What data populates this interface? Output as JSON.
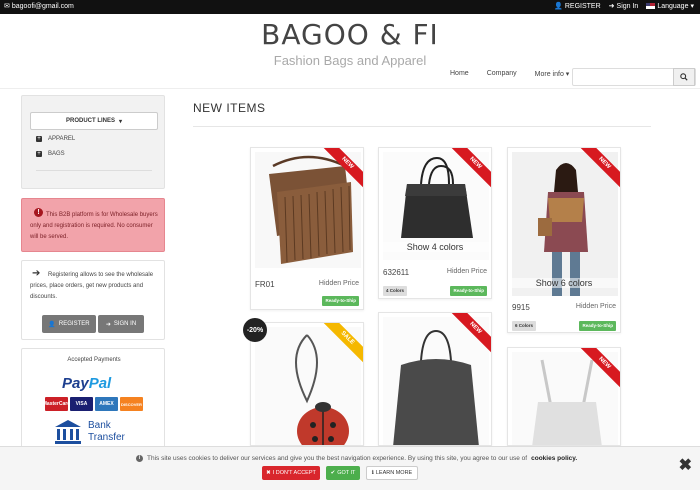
{
  "topbar": {
    "email": "bagoofi@gmail.com",
    "register": "REGISTER",
    "signin": "Sign In",
    "language": "Language"
  },
  "brand": {
    "title": "BAGOO & FI",
    "subtitle": "Fashion Bags and Apparel"
  },
  "nav": {
    "home": "Home",
    "company": "Company",
    "more": "More info"
  },
  "search": {
    "placeholder": ""
  },
  "sidebar": {
    "product_lines": "PRODUCT LINES",
    "items": [
      {
        "label": "APPAREL"
      },
      {
        "label": "BAGS"
      }
    ],
    "alert": "This B2B platform is for Wholesale buyers only and registration is required. No consumer will be served.",
    "register_text": "Registering allows to see the wholesale prices, place orders, get new products and discounts.",
    "register_btn": "REGISTER",
    "signin_btn": "SIGN IN",
    "payments_title": "Accepted Payments",
    "paypal_a": "Pay",
    "paypal_b": "Pal",
    "cards": [
      {
        "label": "MasterCard",
        "color": "#cc2027"
      },
      {
        "label": "VISA",
        "color": "#1a1f71"
      },
      {
        "label": "AMEX",
        "color": "#2e77bb"
      },
      {
        "label": "DISCOVER",
        "color": "#f58220"
      }
    ],
    "bank_line1": "Bank",
    "bank_line2": "Transfer"
  },
  "main": {
    "section_title": "NEW ITEMS",
    "products": [
      {
        "code": "FR01",
        "price": "Hidden Price",
        "badge": "NEW",
        "ready": "Ready-to-Ship",
        "colors_badge": "",
        "show_colors": ""
      },
      {
        "code": "632611",
        "price": "Hidden Price",
        "badge": "NEW",
        "ready": "Ready-to-Ship",
        "colors_badge": "4 Colors",
        "show_colors": "Show 4 colors"
      },
      {
        "code": "9915",
        "price": "Hidden Price",
        "badge": "NEW",
        "ready": "Ready-to-Ship",
        "colors_badge": "6 Colors",
        "show_colors": "Show 6 colors"
      },
      {
        "code": "",
        "price": "",
        "badge": "SALE",
        "discount": "-20%"
      },
      {
        "code": "",
        "price": "",
        "badge": "NEW"
      },
      {
        "code": "",
        "price": "",
        "badge": "NEW"
      }
    ]
  },
  "cookie": {
    "text": "This site uses cookies to deliver our services and give you the best navigation experience. By using this site, you agree to our use of",
    "link": "cookies policy.",
    "dont_accept": "I DON'T ACCEPT",
    "got_it": "GOT IT",
    "learn_more": "LEARN MORE"
  }
}
